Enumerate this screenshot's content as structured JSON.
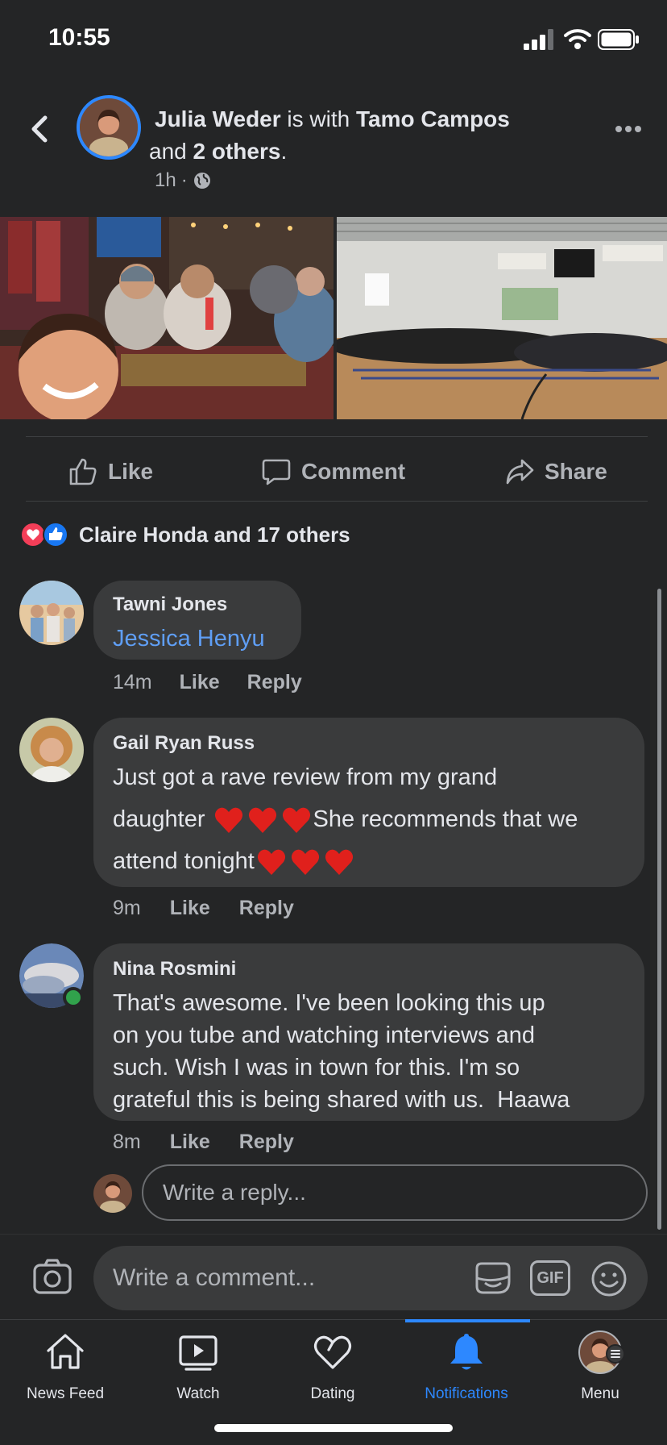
{
  "status_bar": {
    "time": "10:55"
  },
  "post": {
    "author": "Julia Weder",
    "with_text": " is with ",
    "tagged": "Tamo Campos",
    "and_text": " and ",
    "others": "2 others",
    "end": ".",
    "time": "1h",
    "separator": "·",
    "privacy_icon": "globe-icon"
  },
  "actions": {
    "like": "Like",
    "comment": "Comment",
    "share": "Share"
  },
  "reactions": {
    "summary": "Claire Honda and 17 others",
    "icons": [
      "love-reaction-icon",
      "like-reaction-icon"
    ]
  },
  "comments": [
    {
      "author": "Tawni Jones",
      "mention": "Jessica Henyu",
      "time": "14m",
      "like": "Like",
      "reply": "Reply"
    },
    {
      "author": "Gail Ryan Russ",
      "line1": "Just got a rave review from my grand",
      "line2a": "daughter ",
      "line2b": "She recommends that we",
      "line3": "attend tonight",
      "time": "9m",
      "like": "Like",
      "reply": "Reply"
    },
    {
      "author": "Nina Rosmini",
      "line1": "That's awesome. I've been looking this up",
      "line2": "on you tube and watching interviews and",
      "line3": "such. Wish I was in town for this. I'm so",
      "line4": "grateful this is being shared with us.  Haawa",
      "time": "8m",
      "like": "Like",
      "reply": "Reply",
      "online": true
    }
  ],
  "reply_input": {
    "placeholder": "Write a reply..."
  },
  "composer": {
    "placeholder": "Write a comment...",
    "gif_label": "GIF"
  },
  "nav": [
    {
      "label": "News Feed",
      "icon": "home-icon"
    },
    {
      "label": "Watch",
      "icon": "play-icon"
    },
    {
      "label": "Dating",
      "icon": "heart-outline-icon"
    },
    {
      "label": "Notifications",
      "icon": "bell-icon",
      "active": true
    },
    {
      "label": "Menu",
      "icon": "profile-avatar-icon"
    }
  ],
  "colors": {
    "background": "#242526",
    "bubble": "#3a3b3c",
    "accent": "#2d88ff",
    "link": "#5f9ef5",
    "muted": "#b0b3b8"
  }
}
